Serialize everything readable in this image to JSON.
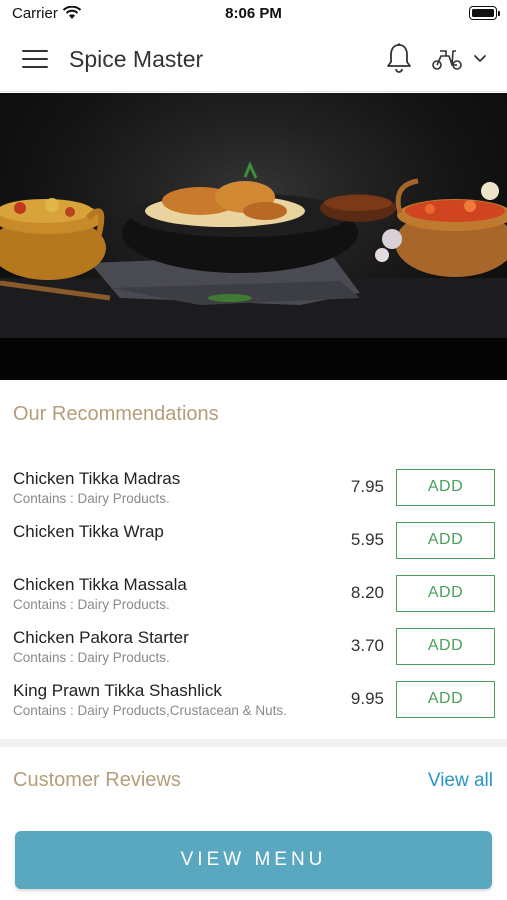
{
  "status_bar": {
    "carrier": "Carrier",
    "time": "8:06 PM"
  },
  "header": {
    "title": "Spice Master",
    "icons": [
      "menu-icon",
      "bell-icon",
      "scooter-icon",
      "chevron-down-icon"
    ]
  },
  "recommendations": {
    "title": "Our Recommendations",
    "add_label": "ADD",
    "items": [
      {
        "name": "Chicken Tikka Madras",
        "contains": "Contains : Dairy Products.",
        "price": "7.95"
      },
      {
        "name": "Chicken Tikka Wrap",
        "contains": "",
        "price": "5.95"
      },
      {
        "name": "Chicken Tikka Massala",
        "contains": "Contains : Dairy Products.",
        "price": "8.20"
      },
      {
        "name": "Chicken Pakora Starter",
        "contains": "Contains : Dairy Products.",
        "price": "3.70"
      },
      {
        "name": "King Prawn Tikka Shashlick",
        "contains": "Contains : Dairy Products,Crustacean & Nuts.",
        "price": "9.95"
      }
    ]
  },
  "reviews": {
    "title": "Customer Reviews",
    "view_all": "View all"
  },
  "footer": {
    "view_menu": "VIEW MENU"
  },
  "colors": {
    "section_title": "#b59d7a",
    "add_green": "#4aa05c",
    "link_blue": "#2a95c5",
    "view_menu_bg": "#5aa7c0"
  }
}
